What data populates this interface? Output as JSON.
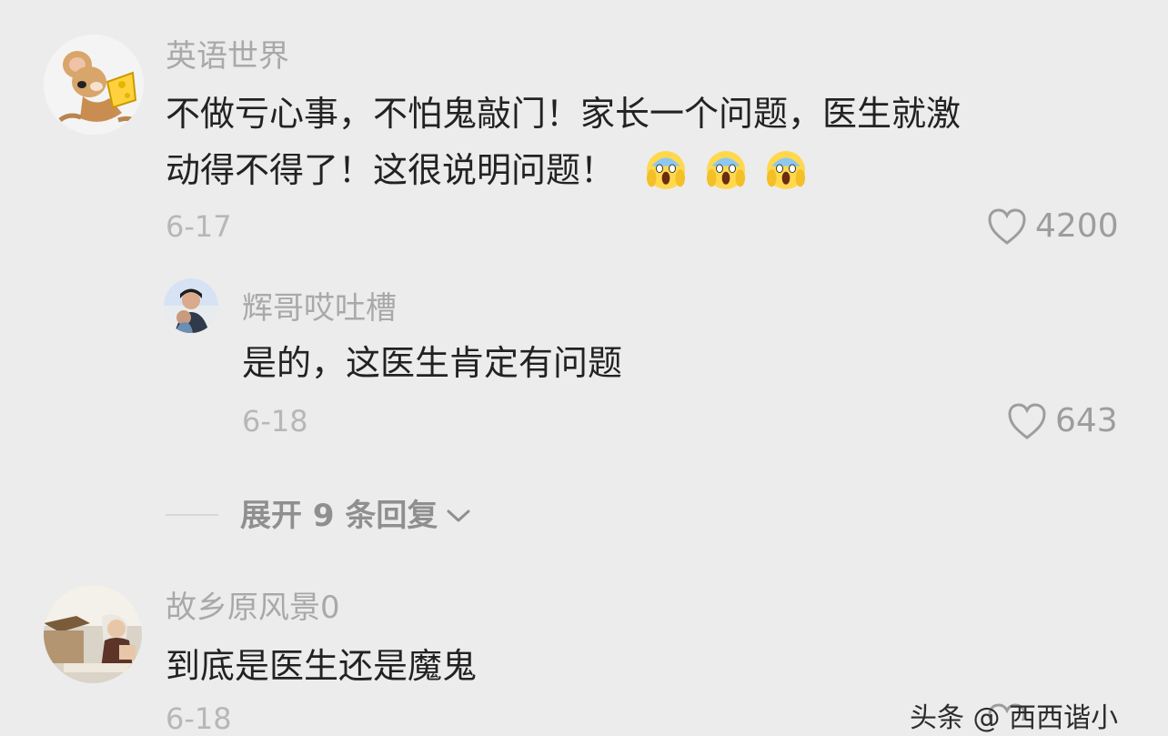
{
  "comments": [
    {
      "username": "英语世界",
      "text_line1": "不做亏心事，不怕鬼敲门！家长一个问题，医生就激",
      "text_line2": "动得不得了！这很说明问题！",
      "date": "6-17",
      "likes": "4200"
    },
    {
      "username": "辉哥哎吐槽",
      "text": "是的，这医生肯定有问题",
      "date": "6-18",
      "likes": "643"
    },
    {
      "username": "故乡原风景0",
      "text": "到底是医生还是魔鬼",
      "date": "6-18"
    }
  ],
  "expand_replies": "展开 9 条回复",
  "watermark": "头条 @ 西西谐小",
  "colors": {
    "background": "#ececec",
    "username": "#a9a9a9",
    "comment_text": "#222222",
    "meta": "#b7b7b7"
  }
}
